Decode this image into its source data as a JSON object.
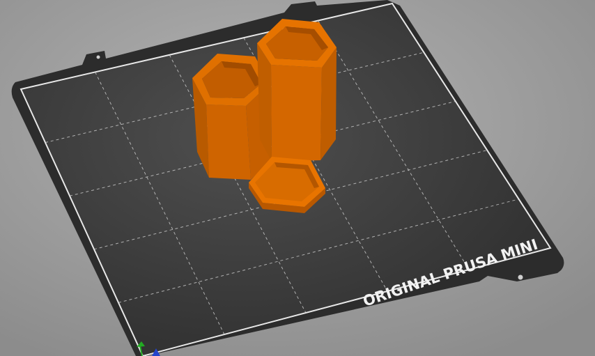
{
  "viewport": {
    "background_color": "#9a9a9a",
    "bed": {
      "label": "ORIGINAL PRUSA MINI",
      "frame_color": "#2a2a2a",
      "surface_color": "#3a3a3a",
      "border_color": "#e8e8e8",
      "grid_color": "#d8d8d8",
      "grid_style": "dashed",
      "grid_divisions": 5
    },
    "objects": {
      "color": "#d96a00",
      "highlight_color": "#f08a1a",
      "shadow_color": "#a84f00",
      "items": [
        {
          "name": "tall-hex-vase"
        },
        {
          "name": "medium-hex-vase"
        },
        {
          "name": "hex-tray"
        }
      ]
    },
    "axes_gizmo": {
      "x_color": "#cc2222",
      "y_color": "#22aa22",
      "z_color": "#2244cc"
    }
  }
}
